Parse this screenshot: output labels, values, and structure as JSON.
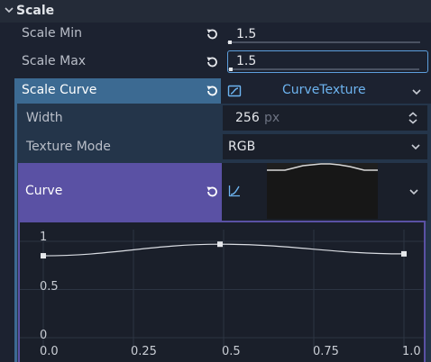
{
  "section": {
    "title": "Scale"
  },
  "scale_min": {
    "label": "Scale Min",
    "value": "1.5"
  },
  "scale_max": {
    "label": "Scale Max",
    "value": "1.5"
  },
  "scale_curve": {
    "label": "Scale Curve",
    "resource": "CurveTexture"
  },
  "width": {
    "label": "Width",
    "value": "256",
    "unit": "px"
  },
  "texture_mode": {
    "label": "Texture Mode",
    "value": "RGB"
  },
  "curve": {
    "label": "Curve"
  },
  "curve_editor": {
    "y_ticks": [
      "1",
      "0.5",
      "0"
    ],
    "x_ticks": [
      "0.0",
      "0.25",
      "0.5",
      "0.75",
      "1.0"
    ],
    "points": [
      {
        "x": 0.0,
        "y": 0.85
      },
      {
        "x": 0.49,
        "y": 0.97
      },
      {
        "x": 1.0,
        "y": 0.87
      }
    ]
  },
  "colors": {
    "accent": "#5d9fdc",
    "curve_header": "#3c6a92",
    "curve_property": "#5a51a4",
    "link_text": "#6db4f0"
  }
}
